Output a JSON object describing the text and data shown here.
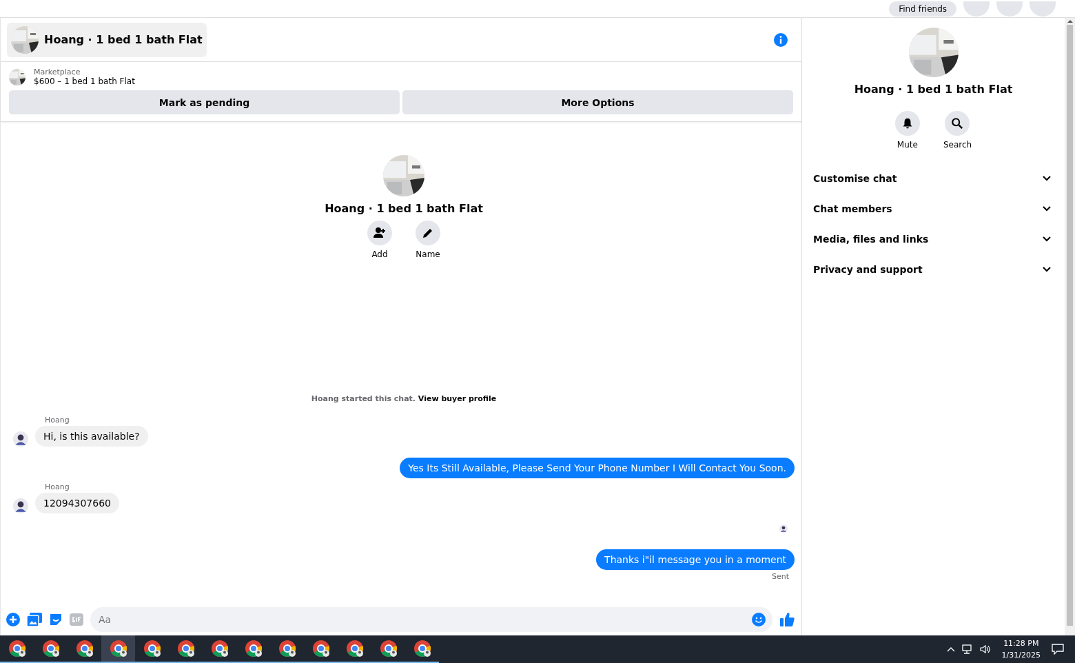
{
  "top_bar": {
    "find_friends": "Find friends"
  },
  "chat": {
    "title": "Hoang · 1 bed 1 bath Flat",
    "listing": {
      "source": "Marketplace",
      "summary": "$600 – 1 bed 1 bath Flat"
    },
    "actions": [
      "Mark as pending",
      "More Options"
    ],
    "intro": {
      "title": "Hoang · 1 bed 1 bath Flat",
      "actions": [
        {
          "kind": "add",
          "label": "Add"
        },
        {
          "kind": "name",
          "label": "Name"
        }
      ]
    },
    "notice": {
      "text": "Hoang started this chat.",
      "link": "View buyer profile"
    },
    "messages": [
      {
        "incoming": true,
        "sender": "Hoang",
        "text": "Hi, is this available?"
      },
      {
        "incoming": false,
        "text": "Yes Its Still Available, Please Send Your Phone Number I Will Contact You Soon."
      },
      {
        "incoming": true,
        "sender": "Hoang",
        "text": "12094307660"
      },
      {
        "incoming": false,
        "text": "Thanks i\"il message you in a moment",
        "status": "Sent"
      }
    ],
    "composer": {
      "placeholder": "Aa"
    }
  },
  "details": {
    "title": "Hoang · 1 bed 1 bath Flat",
    "actions": [
      {
        "kind": "mute",
        "label": "Mute"
      },
      {
        "kind": "search",
        "label": "Search"
      }
    ],
    "sections": [
      {
        "label": "Customise chat",
        "expanded": false
      },
      {
        "label": "Chat members",
        "expanded": false
      },
      {
        "label": "Media, files and links",
        "expanded": false
      },
      {
        "label": "Privacy and support",
        "expanded": false
      }
    ]
  },
  "taskbar": {
    "apps": [
      {
        "selected": false
      },
      {
        "selected": false
      },
      {
        "selected": false
      },
      {
        "selected": true
      },
      {
        "selected": false
      },
      {
        "selected": false
      },
      {
        "selected": false
      },
      {
        "selected": false
      },
      {
        "selected": false
      },
      {
        "selected": false
      },
      {
        "selected": false
      },
      {
        "selected": false
      },
      {
        "selected": false
      }
    ],
    "time": "11:28 PM",
    "date": "1/31/2025"
  }
}
